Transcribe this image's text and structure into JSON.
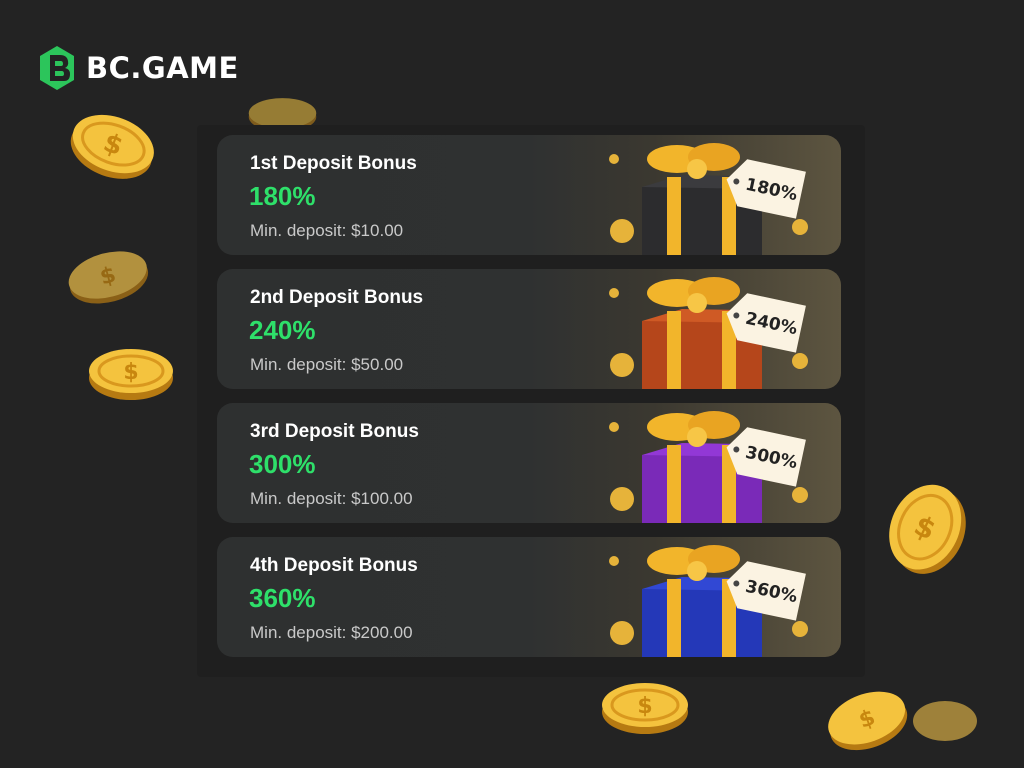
{
  "brand": {
    "name": "BC.GAME",
    "logo_color": "#2cc55b"
  },
  "bonuses": [
    {
      "title": "1st Deposit Bonus",
      "percent": "180%",
      "min_deposit": "Min. deposit: $10.00",
      "tag": "180%",
      "box_color": "#2c2c2e"
    },
    {
      "title": "2nd Deposit Bonus",
      "percent": "240%",
      "min_deposit": "Min. deposit: $50.00",
      "tag": "240%",
      "box_color": "#b5461b"
    },
    {
      "title": "3rd Deposit Bonus",
      "percent": "300%",
      "min_deposit": "Min. deposit: $100.00",
      "tag": "300%",
      "box_color": "#7a2ab8"
    },
    {
      "title": "4th Deposit Bonus",
      "percent": "360%",
      "min_deposit": "Min. deposit: $200.00",
      "tag": "360%",
      "box_color": "#2438b8"
    }
  ],
  "colors": {
    "accent_green": "#2ee06a",
    "gold": "#f2b52b"
  },
  "icons": [
    "bc-game-logo-icon",
    "gift-box-icon",
    "price-tag-icon",
    "gold-coin-icon"
  ]
}
